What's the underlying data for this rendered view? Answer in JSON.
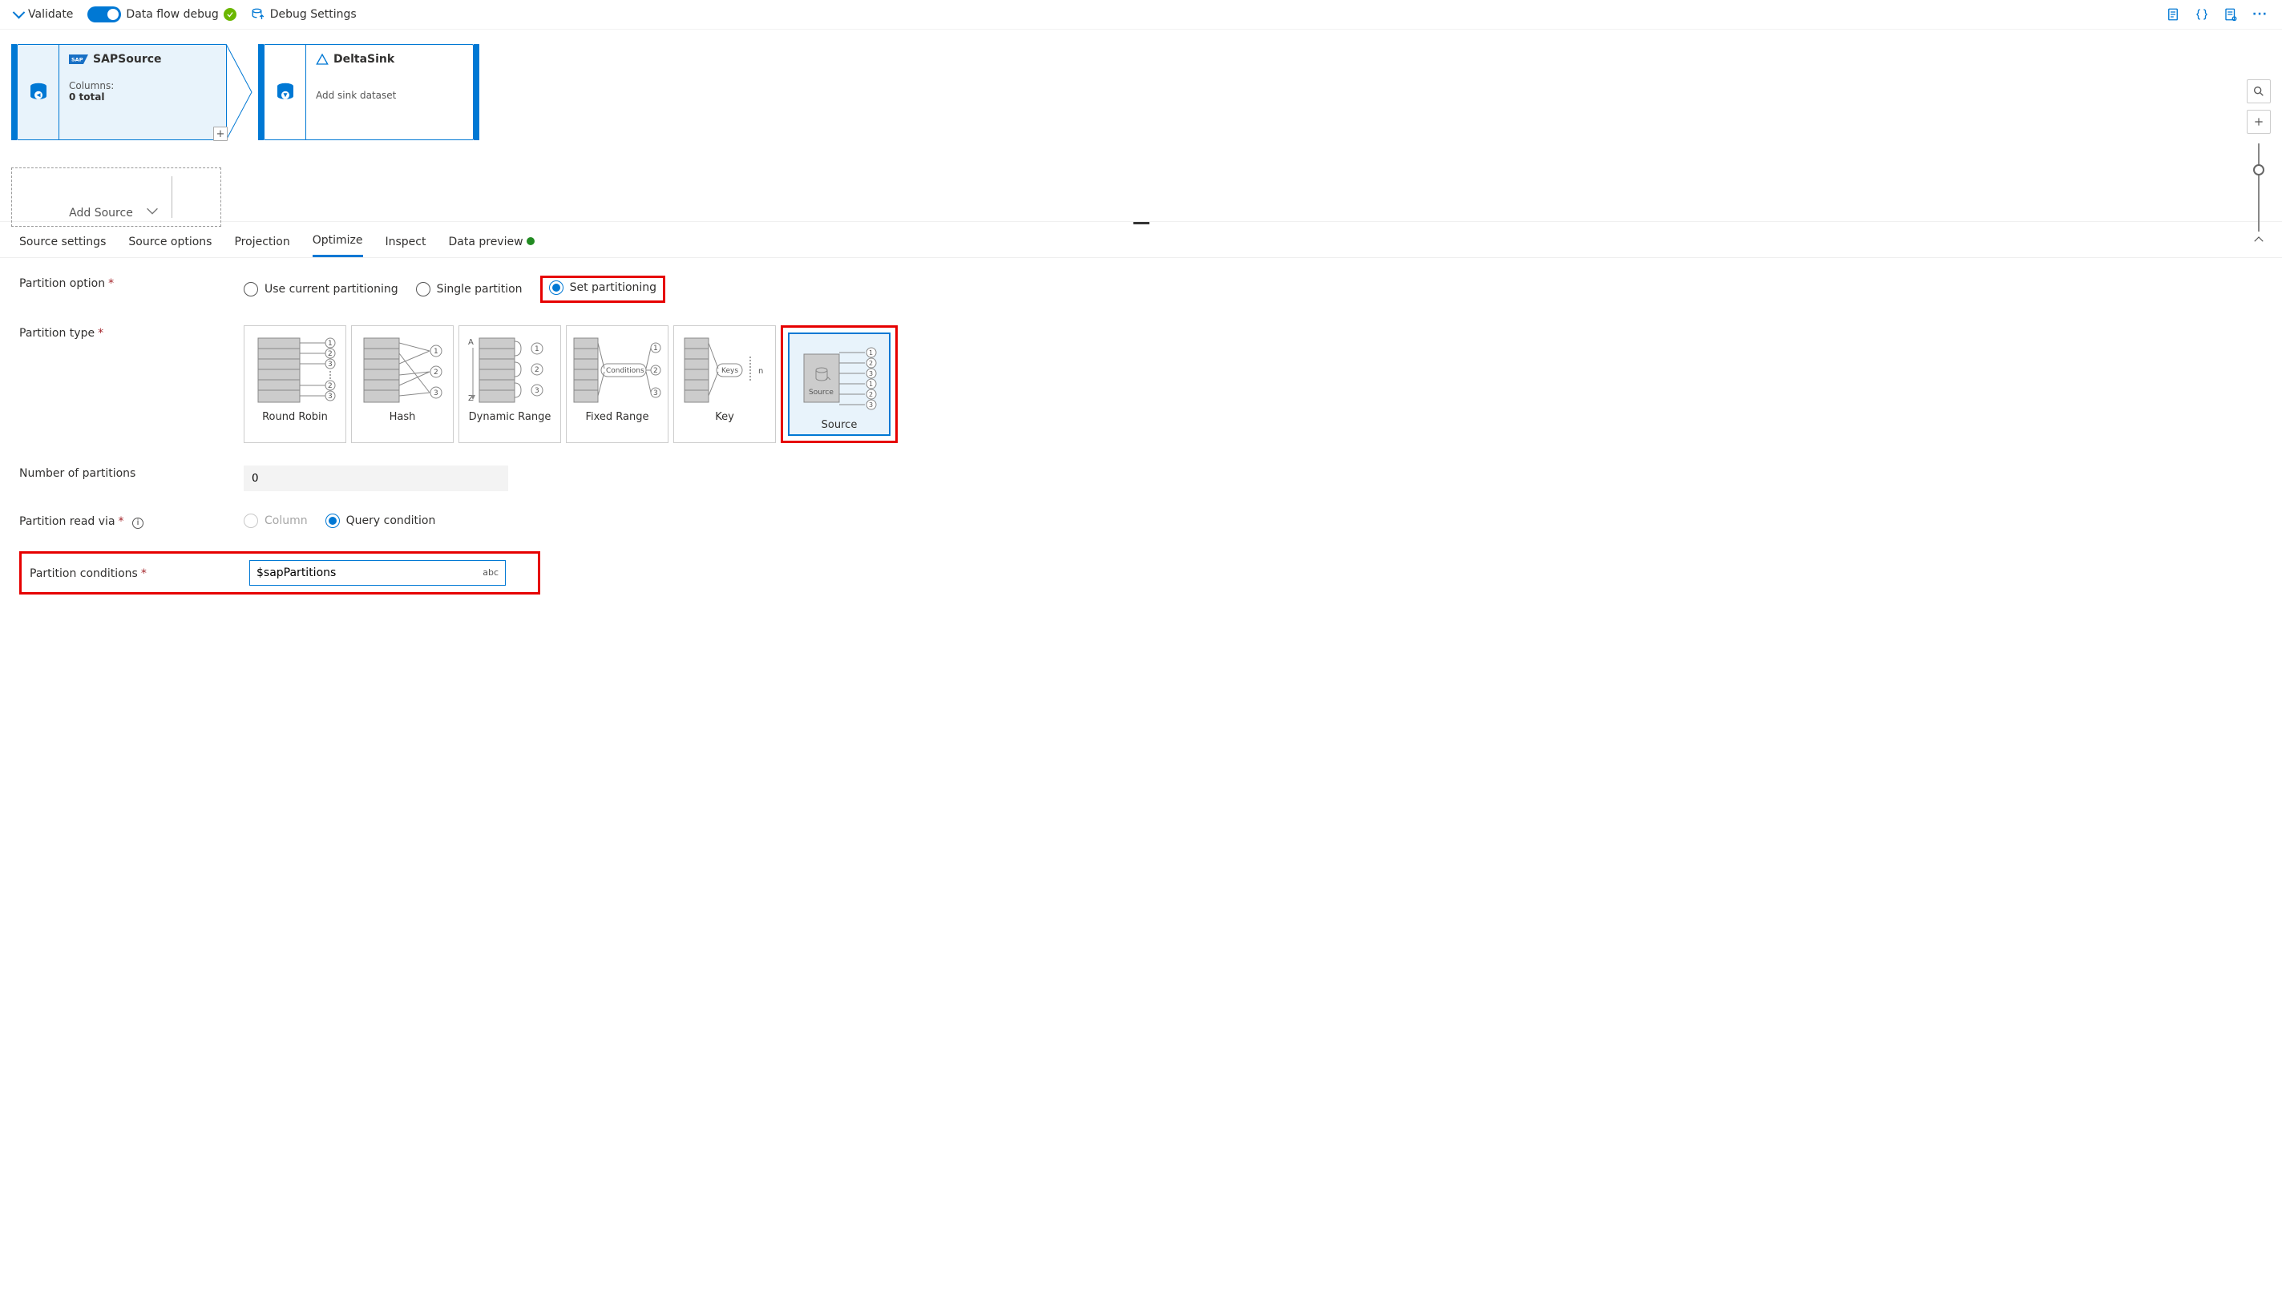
{
  "toolbar": {
    "validate": "Validate",
    "debug_label": "Data flow debug",
    "debug_settings": "Debug Settings"
  },
  "nodes": {
    "source": {
      "title": "SAPSource",
      "columns_label": "Columns:",
      "columns_value": "0 total"
    },
    "sink": {
      "title": "DeltaSink",
      "subtitle": "Add sink dataset"
    },
    "add_source": "Add Source"
  },
  "tabs": {
    "t0": "Source settings",
    "t1": "Source options",
    "t2": "Projection",
    "t3": "Optimize",
    "t4": "Inspect",
    "t5": "Data preview"
  },
  "labels": {
    "partition_option": "Partition option",
    "partition_type": "Partition type",
    "num_partitions": "Number of partitions",
    "read_via": "Partition read via",
    "conditions": "Partition conditions"
  },
  "partition_option": {
    "o0": "Use current partitioning",
    "o1": "Single partition",
    "o2": "Set partitioning"
  },
  "partition_types": {
    "p0": "Round Robin",
    "p1": "Hash",
    "p2": "Dynamic Range",
    "p3": "Fixed Range",
    "p4": "Key",
    "p5": "Source"
  },
  "num_partitions_value": "0",
  "read_via": {
    "o0": "Column",
    "o1": "Query condition"
  },
  "conditions_value": "$sapPartitions",
  "abc_tag": "abc"
}
